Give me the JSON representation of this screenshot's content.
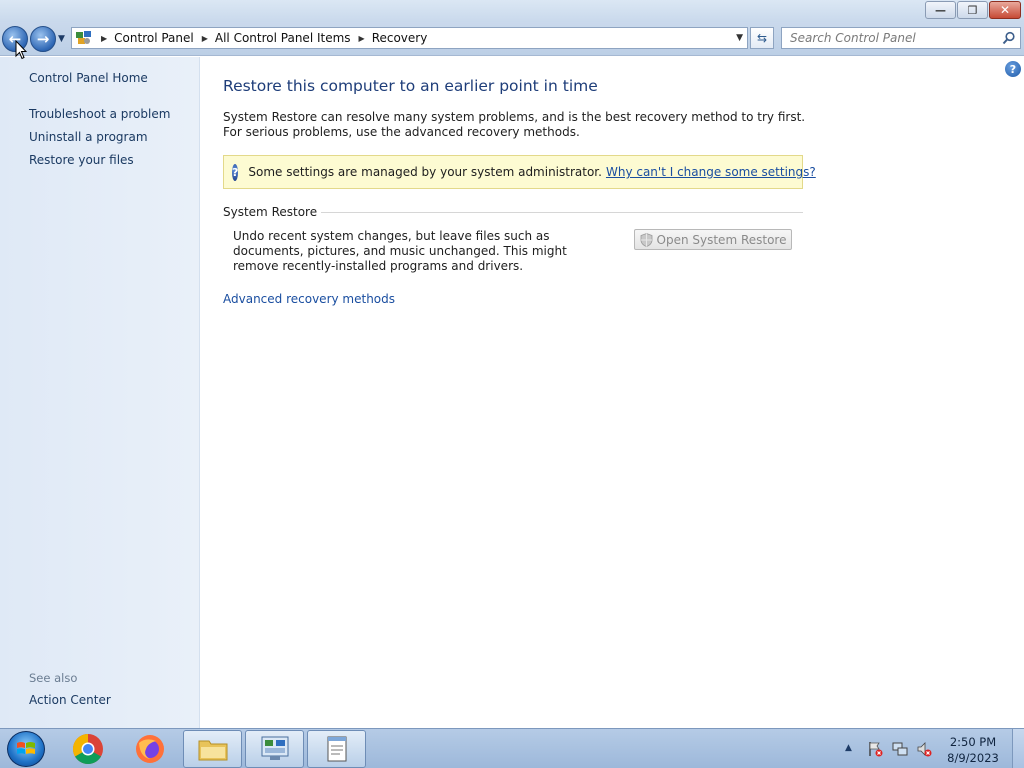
{
  "window": {
    "minimize_glyph": "—",
    "maximize_glyph": "❐",
    "close_glyph": "✕"
  },
  "nav": {
    "back_glyph": "←",
    "forward_glyph": "→",
    "recent_glyph": "▼"
  },
  "address": {
    "crumbs": [
      "Control Panel",
      "All Control Panel Items",
      "Recovery"
    ],
    "separator": "▶",
    "dropdown_glyph": "▼",
    "refresh_glyph": "⇆"
  },
  "search": {
    "placeholder": "Search Control Panel",
    "value": ""
  },
  "sidebar": {
    "home": "Control Panel Home",
    "links": [
      "Troubleshoot a problem",
      "Uninstall a program",
      "Restore your files"
    ],
    "see_also_heading": "See also",
    "see_also_links": [
      "Action Center"
    ]
  },
  "main": {
    "help_glyph": "?",
    "title": "Restore this computer to an earlier point in time",
    "intro": "System Restore can resolve many system problems, and is the best recovery method to try first. For serious problems, use the advanced recovery methods.",
    "info_bar": {
      "icon_glyph": "?",
      "text": "Some settings are managed by your system administrator.",
      "link": "Why can't I change some settings?"
    },
    "system_restore": {
      "heading": "System Restore",
      "description": "Undo recent system changes, but leave files such as documents, pictures, and music unchanged. This might remove recently-installed programs and drivers.",
      "button_label": "Open System Restore",
      "button_enabled": false
    },
    "advanced_link": "Advanced recovery methods"
  },
  "taskbar": {
    "pinned": [
      "start-button",
      "chrome",
      "firefox",
      "windows-explorer",
      "control-panel",
      "notepad"
    ],
    "clock_time": "2:50 PM",
    "clock_date": "8/9/2023",
    "tray_arrow_glyph": "▲"
  },
  "colors": {
    "link": "#1a4ea0",
    "title": "#1e3d79",
    "info_bar_bg": "#fdfbd2",
    "sidebar_bg": "#e3ecf7",
    "taskbar": "#a9c1e2"
  }
}
